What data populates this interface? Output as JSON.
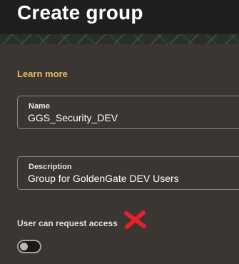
{
  "header": {
    "title": "Create group"
  },
  "learn_more": {
    "label": "Learn more"
  },
  "form": {
    "name": {
      "label": "Name",
      "value": "GGS_Security_DEV"
    },
    "description": {
      "label": "Description",
      "value": "Group for GoldenGate DEV Users"
    },
    "request_access": {
      "label": "User can request access",
      "enabled": false
    }
  },
  "annotation": {
    "icon": "red-x-mark-icon",
    "color": "#e8202a"
  },
  "colors": {
    "accent": "#e8b964",
    "background": "#3b3631",
    "header": "#1f1f1f"
  }
}
